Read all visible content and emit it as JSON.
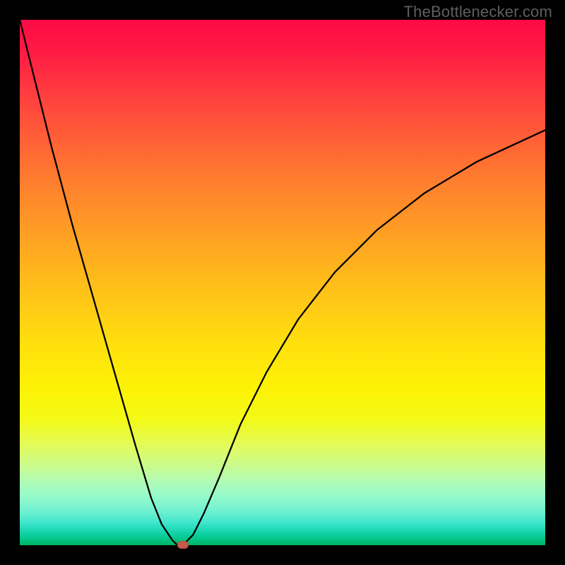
{
  "watermark": "TheBottlenecker.com",
  "colors": {
    "frame_border": "#000000",
    "curve_stroke": "#000000",
    "dot_fill": "#c45a4a"
  },
  "chart_data": {
    "type": "line",
    "title": "",
    "xlabel": "",
    "ylabel": "",
    "xlim": [
      0,
      100
    ],
    "ylim": [
      0,
      100
    ],
    "series": [
      {
        "name": "curve",
        "x": [
          0,
          3,
          6,
          10,
          14,
          18,
          22,
          25,
          27,
          29,
          30,
          31,
          32,
          33,
          35,
          38,
          42,
          47,
          53,
          60,
          68,
          77,
          87,
          100
        ],
        "values": [
          100,
          88,
          76,
          61,
          47,
          33,
          19,
          9,
          4,
          1,
          0,
          0,
          1,
          2,
          6,
          13,
          23,
          33,
          43,
          52,
          60,
          67,
          73,
          79
        ]
      }
    ],
    "marker": {
      "x": 31,
      "y": 0,
      "color": "#c45a4a"
    },
    "gradient_stops": [
      {
        "pos": 0.0,
        "color": "#ff0a46"
      },
      {
        "pos": 0.5,
        "color": "#ffc916"
      },
      {
        "pos": 0.8,
        "color": "#e2fb5a"
      },
      {
        "pos": 1.0,
        "color": "#00b360"
      }
    ]
  }
}
